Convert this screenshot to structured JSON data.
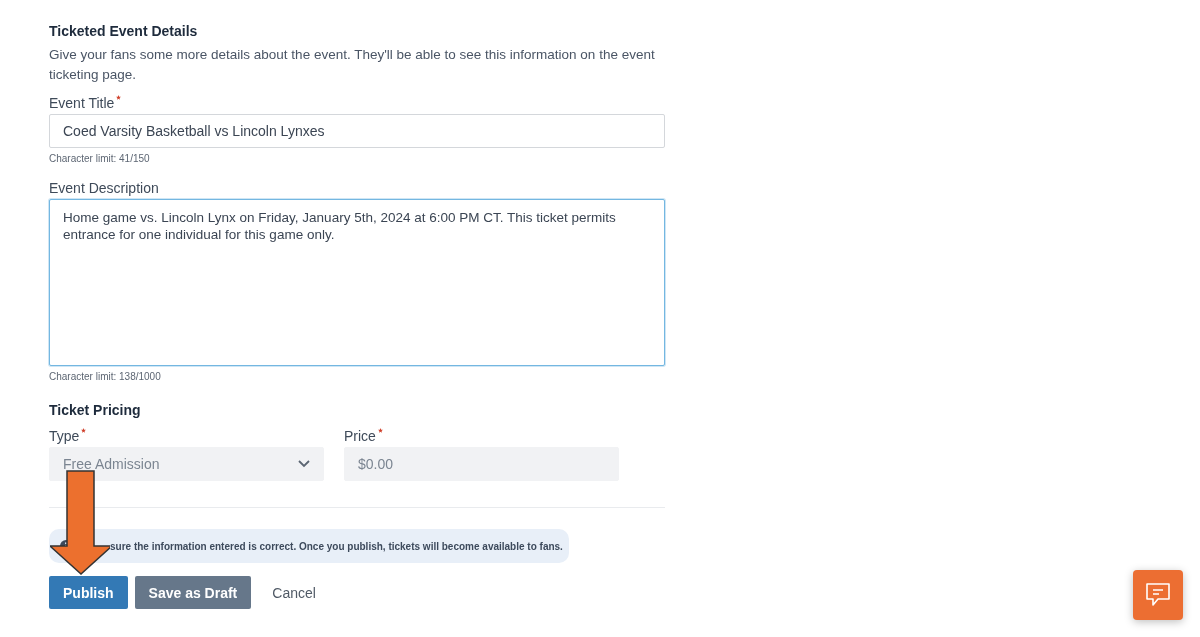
{
  "section": {
    "heading": "Ticketed Event Details",
    "description": "Give your fans some more details about the event. They'll be able to see this information on the event ticketing page."
  },
  "fields": [
    {
      "kind": "input",
      "label": "Event Title",
      "required": true,
      "value": "Coed Varsity Basketball vs Lincoln Lynxes",
      "hint": "Character limit: 41/150",
      "focused": false
    },
    {
      "kind": "textarea",
      "label": "Event Description",
      "required": false,
      "value": "Home game vs. Lincoln Lynx on Friday, January 5th, 2024 at 6:00 PM CT. This ticket permits entrance for one individual for this game only.",
      "hint": "Character limit: 138/1000",
      "focused": true
    }
  ],
  "pricing": {
    "heading": "Ticket Pricing",
    "fields": [
      {
        "kind": "select",
        "label": "Type",
        "required": true,
        "value": "Free Admission",
        "disabled": true
      },
      {
        "kind": "input",
        "label": "Price",
        "required": true,
        "value": "$0.00",
        "disabled": true
      }
    ]
  },
  "notice": {
    "text": "sure the information entered is correct. Once you publish, tickets will become available to fans."
  },
  "buttons": [
    {
      "kind": "primary",
      "label": "Publish"
    },
    {
      "kind": "secondary",
      "label": "Save as Draft"
    },
    {
      "kind": "link",
      "label": "Cancel"
    }
  ]
}
